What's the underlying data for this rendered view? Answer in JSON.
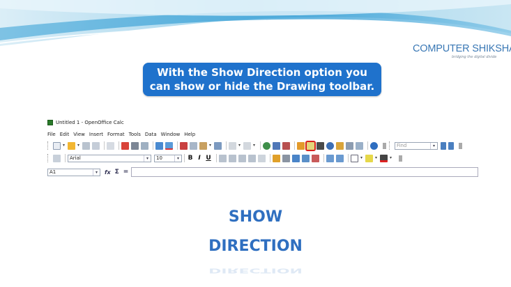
{
  "brand": {
    "name_part1": "COMPUTER",
    "name_part2": "SHIKSHA",
    "tagline": "bridging the digital divide"
  },
  "callout": {
    "line1": "With the Show Direction option you",
    "line2": "can show or hide the Drawing toolbar."
  },
  "window": {
    "title": "Untitled 1 - OpenOffice Calc",
    "menu": [
      "File",
      "Edit",
      "View",
      "Insert",
      "Format",
      "Tools",
      "Data",
      "Window",
      "Help"
    ]
  },
  "toolbar": {
    "find_placeholder": "Find",
    "font_name": "Arial",
    "font_size": "10",
    "bold_label": "B",
    "italic_label": "I",
    "underline_label": "U"
  },
  "formula_bar": {
    "name_box": "A1",
    "function_symbol": "fx",
    "sum_symbol": "Σ",
    "equals_symbol": "="
  },
  "heading": {
    "line1": "SHOW",
    "line2": "DIRECTION"
  },
  "colors": {
    "accent_blue": "#1f72cc",
    "title_blue": "#2f6fc0",
    "highlight_red": "#d8201c"
  }
}
